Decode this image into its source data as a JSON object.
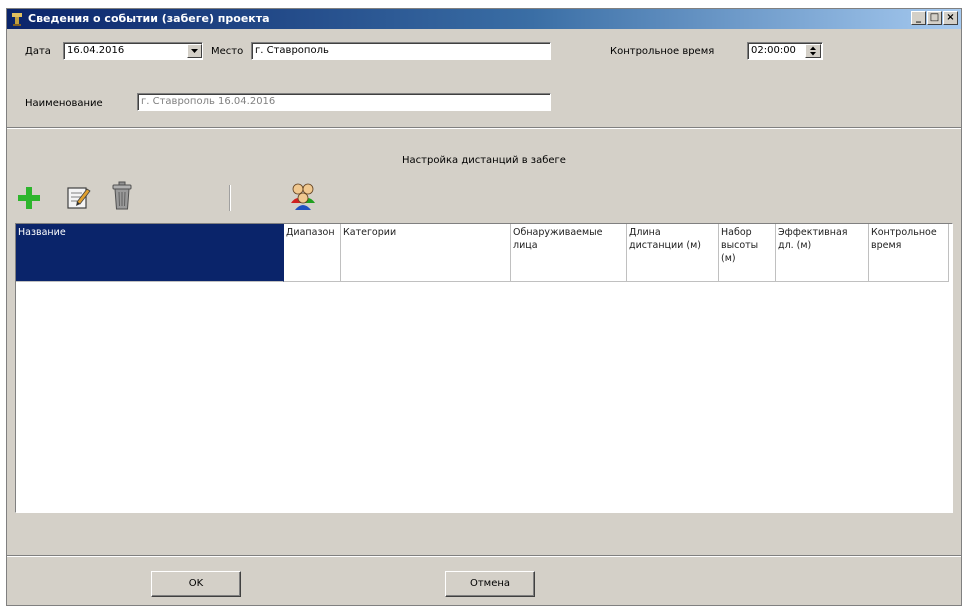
{
  "window": {
    "title": "Сведения о событии (забеге) проекта",
    "controls": [
      "_",
      "□",
      "×"
    ]
  },
  "form": {
    "date_label": "Дата",
    "date_value": "16.04.2016",
    "place_label": "Место",
    "place_value": "г. Ставрополь",
    "control_time_label": "Контрольное время",
    "control_time_value": "02:00:00",
    "name_label": "Наименование",
    "name_value": "г. Ставрополь 16.04.2016"
  },
  "section": {
    "title": "Настройка дистанций в забеге"
  },
  "toolbar": {
    "icons": [
      "add-icon",
      "edit-icon",
      "delete-icon",
      "participants-icon"
    ],
    "colors": {
      "add": "#2db52d",
      "edit_paper": "#f4f4f4",
      "trash": "#9a9a9a"
    }
  },
  "grid": {
    "columns": [
      "Название",
      "Диапазон",
      "Категории",
      "Обнаруживаемые лица",
      "Длина дистанции (м)",
      "Набор высоты (м)",
      "Эффективная дл. (м)",
      "Контрольное время"
    ],
    "rows": []
  },
  "buttons": {
    "ok": "OK",
    "cancel": "Отмена"
  },
  "colors": {
    "titlebar_start": "#0a246a",
    "titlebar_end": "#a6caf0",
    "face": "#d4d0c8",
    "selection": "#0a246a"
  }
}
